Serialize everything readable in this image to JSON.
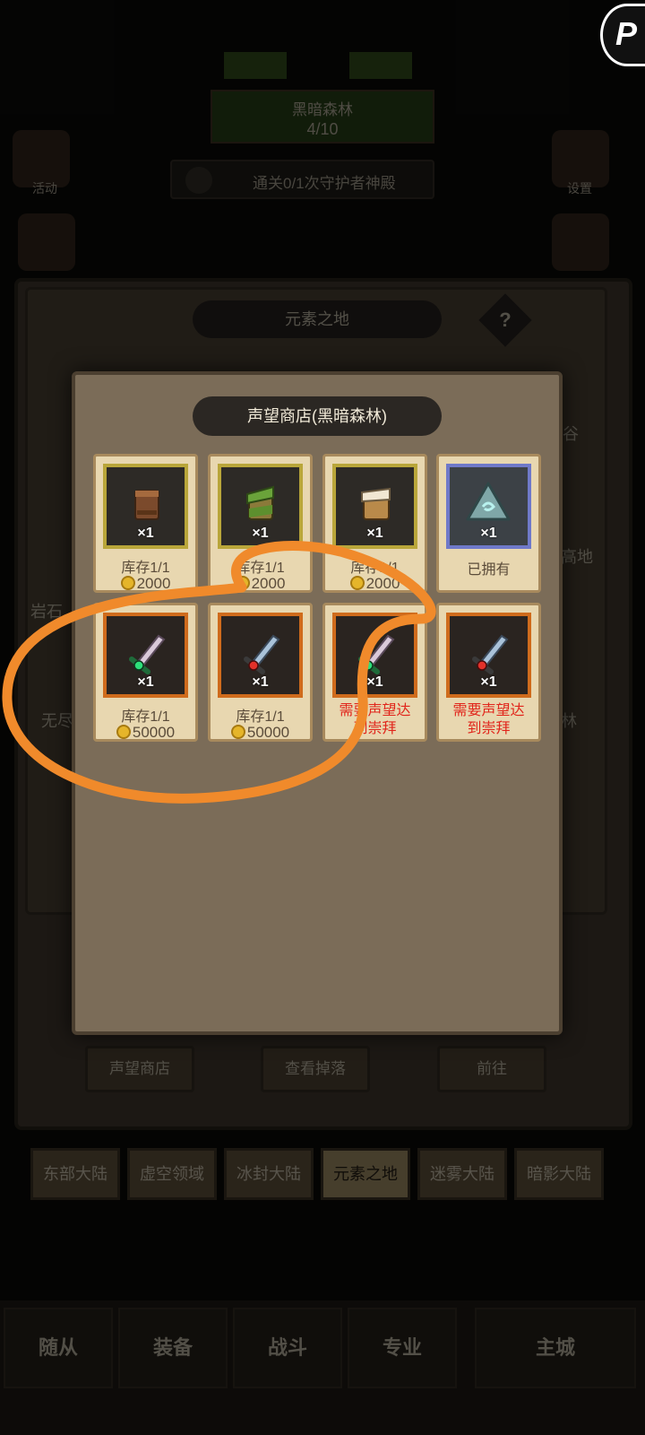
{
  "background": {
    "map_name": "黑暗森林",
    "map_progress": "4/10",
    "quest_text": "通关0/1次守护者神殿",
    "left_side_label": "活动",
    "right_side_label": "设置",
    "region_title": "元素之地",
    "help_symbol": "?",
    "peek_texts": [
      "岩石",
      "无尽",
      "高地",
      "谷",
      "林"
    ],
    "bottom_buttons": [
      "声望商店",
      "查看掉落",
      "前往"
    ],
    "continents": [
      "东部大陆",
      "虚空领域",
      "冰封大陆",
      "元素之地",
      "迷雾大陆",
      "暗影大陆"
    ],
    "active_continent": "元素之地",
    "nav_items": [
      "随从",
      "装备",
      "战斗",
      "专业",
      "主城"
    ]
  },
  "shop": {
    "title": "声望商店(黑暗森林)",
    "items": [
      {
        "icon": "leather-bracer-icon",
        "frame": "gold",
        "qty": "×1",
        "stock": "库存1/1",
        "price": "2000"
      },
      {
        "icon": "green-bracer-icon",
        "frame": "gold",
        "qty": "×1",
        "stock": "库存1/1",
        "price": "2000"
      },
      {
        "icon": "cloth-bracer-icon",
        "frame": "gold",
        "qty": "×1",
        "stock": "库存1/1",
        "price": "2000"
      },
      {
        "icon": "rune-stone-icon",
        "frame": "blue",
        "qty": "×1",
        "status": "已拥有"
      },
      {
        "icon": "green-gem-dagger-icon",
        "frame": "orange",
        "qty": "×1",
        "stock": "库存1/1",
        "price": "50000"
      },
      {
        "icon": "red-gem-dagger-icon",
        "frame": "orange",
        "qty": "×1",
        "stock": "库存1/1",
        "price": "50000"
      },
      {
        "icon": "green-gem-dagger-icon",
        "frame": "orange",
        "qty": "×1",
        "requirement": "需要声望达到崇拜"
      },
      {
        "icon": "red-gem-dagger-icon",
        "frame": "orange",
        "qty": "×1",
        "requirement": "需要声望达到崇拜"
      }
    ]
  },
  "colors": {
    "annotation": "#f08a2b",
    "requirement_text": "#e1251b",
    "coin": "#e5b52a"
  }
}
